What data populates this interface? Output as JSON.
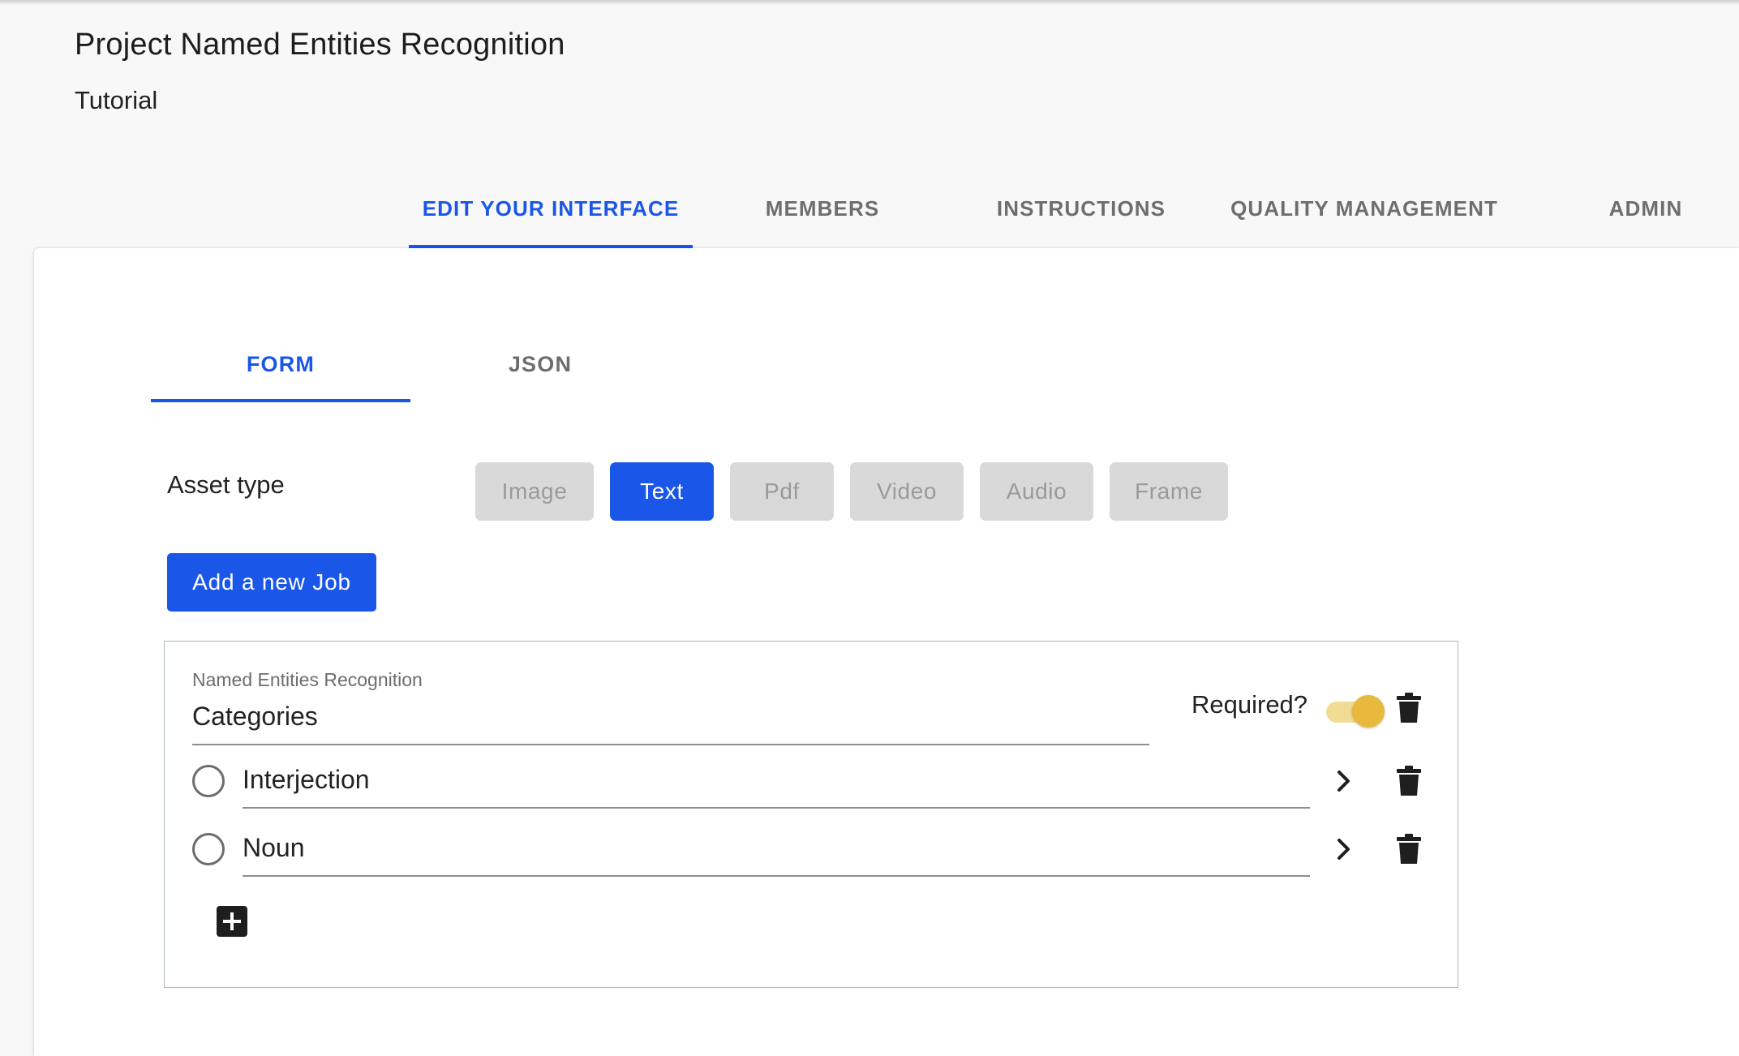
{
  "project": {
    "title": "Project Named Entities Recognition",
    "subtitle": "Tutorial"
  },
  "main_tabs": [
    {
      "label": "EDIT YOUR INTERFACE",
      "active": true
    },
    {
      "label": "MEMBERS",
      "active": false
    },
    {
      "label": "INSTRUCTIONS",
      "active": false
    },
    {
      "label": "QUALITY MANAGEMENT",
      "active": false
    },
    {
      "label": "ADMIN",
      "active": false
    }
  ],
  "sub_tabs": [
    {
      "label": "FORM",
      "active": true
    },
    {
      "label": "JSON",
      "active": false
    }
  ],
  "asset_type": {
    "label": "Asset type",
    "options": [
      "Image",
      "Text",
      "Pdf",
      "Video",
      "Audio",
      "Frame"
    ],
    "selected": "Text"
  },
  "add_job_label": "Add a new Job",
  "job": {
    "caption": "Named Entities Recognition",
    "title": "Categories",
    "required_label": "Required?",
    "required": true,
    "categories": [
      {
        "label": "Interjection"
      },
      {
        "label": "Noun"
      }
    ]
  },
  "colors": {
    "accent": "#1a56e8",
    "toggle_thumb": "#e8b93a",
    "toggle_track": "#f0dc93",
    "disabled_button": "#d9d9d9"
  },
  "icons": {
    "delete": "trash-icon",
    "expand": "chevron-right-icon",
    "add": "plus-square-icon",
    "radio": "radio-unchecked-icon"
  }
}
